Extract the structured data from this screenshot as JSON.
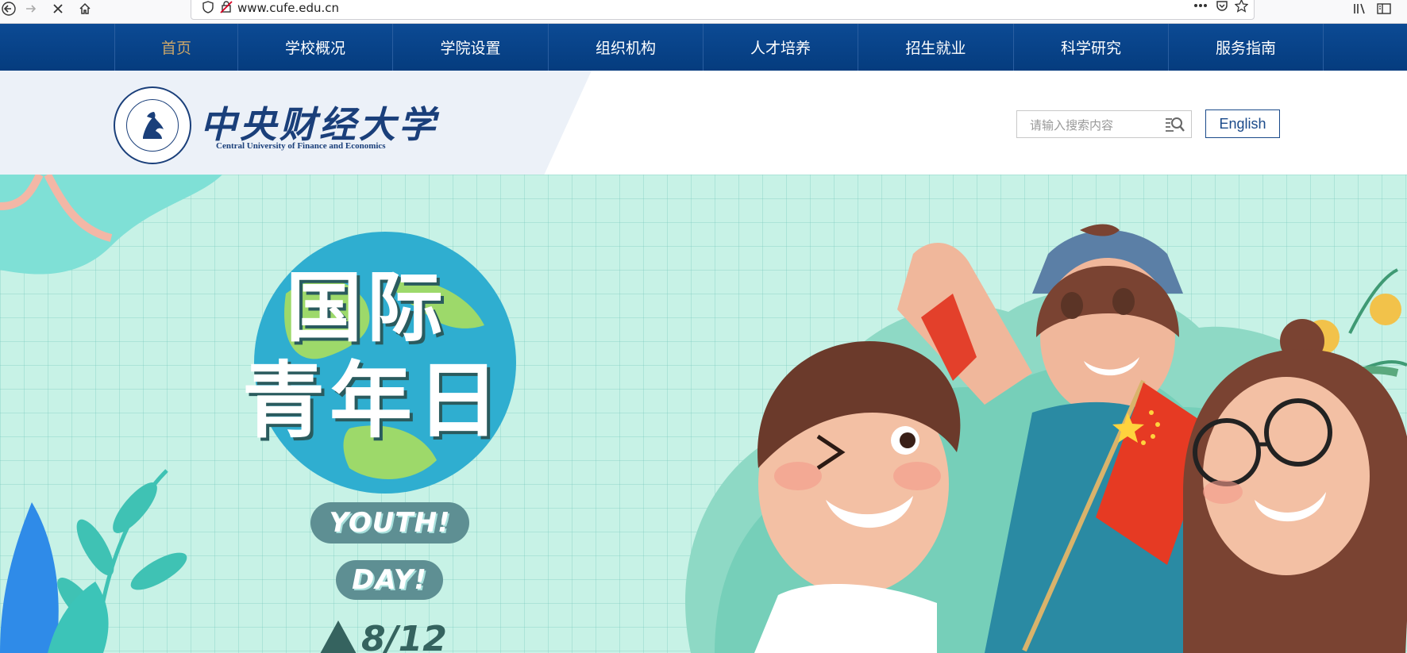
{
  "browser": {
    "url": "www.cufe.edu.cn"
  },
  "nav": {
    "items": [
      "首页",
      "学校概况",
      "学院设置",
      "组织机构",
      "人才培养",
      "招生就业",
      "科学研究",
      "服务指南"
    ]
  },
  "header": {
    "logo_cn": "中央财经大学",
    "logo_en": "Central University of Finance and Economics",
    "search_placeholder": "请输入搜索内容",
    "english_button": "English"
  },
  "banner": {
    "title_line1": "国际",
    "title_line2": "青年日",
    "pill1": "YOUTH!",
    "pill2": "DAY!",
    "date": "8/12"
  },
  "colors": {
    "nav_bg": "#0c4a94",
    "nav_active": "#c9a56a",
    "brand_blue": "#1a3f7a",
    "banner_bg": "#c7f2e6"
  }
}
